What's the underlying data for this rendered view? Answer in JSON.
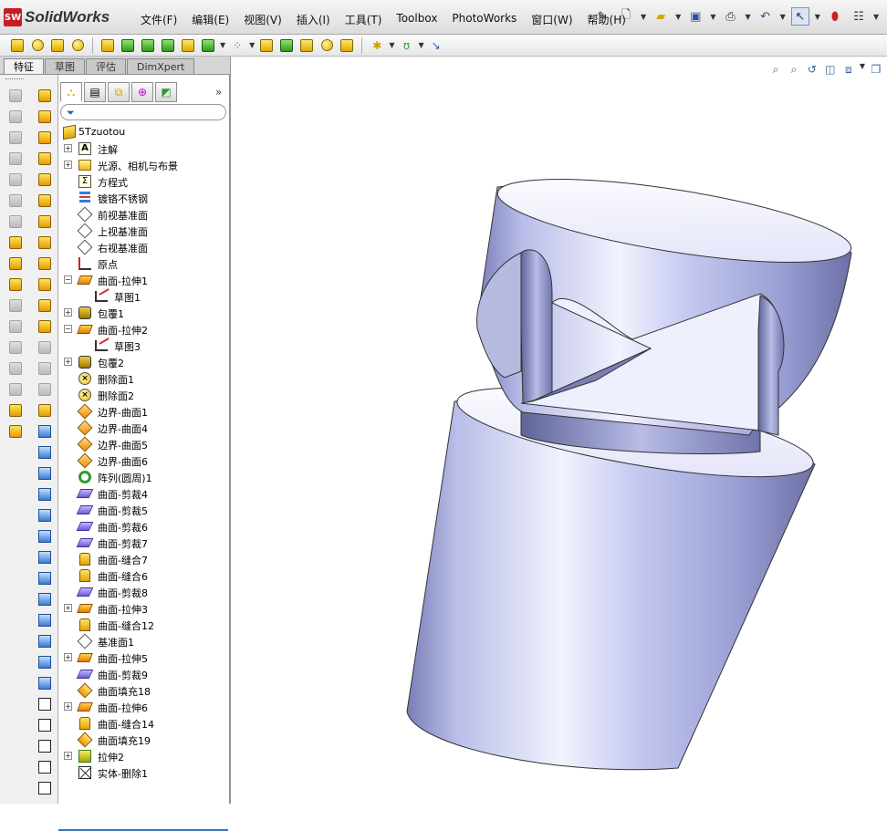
{
  "app": {
    "name": "SolidWorks",
    "logo_text": "SW"
  },
  "menu": [
    "文件(F)",
    "编辑(E)",
    "视图(V)",
    "插入(I)",
    "工具(T)",
    "Toolbox",
    "PhotoWorks",
    "窗口(W)",
    "帮助(H)"
  ],
  "quick_access": [
    "pin-icon",
    "new-document-icon",
    "open-icon",
    "save-icon",
    "print-icon",
    "undo-icon",
    "select-icon",
    "rebuild-icon",
    "options-icon"
  ],
  "command_tabs": [
    {
      "label": "特征",
      "active": true
    },
    {
      "label": "草图",
      "active": false
    },
    {
      "label": "评估",
      "active": false
    },
    {
      "label": "DimXpert",
      "active": false
    }
  ],
  "feature_manager": {
    "tabs": [
      "featuremanager-tab-icon",
      "propertymanager-tab-icon",
      "configurationmanager-tab-icon",
      "dimxpertmanager-tab-icon",
      "display-manager-tab-icon"
    ],
    "more_label": "»",
    "root": "5Tzuotou",
    "items": [
      {
        "label": "注解",
        "icon": "annotations",
        "exp": "+",
        "indent": 0
      },
      {
        "label": "光源、相机与布景",
        "icon": "lights",
        "exp": "+",
        "indent": 0
      },
      {
        "label": "方程式",
        "icon": "equations",
        "exp": "",
        "indent": 0
      },
      {
        "label": "镀铬不锈钢",
        "icon": "material",
        "exp": "",
        "indent": 0
      },
      {
        "label": "前视基准面",
        "icon": "plane",
        "exp": "",
        "indent": 0
      },
      {
        "label": "上视基准面",
        "icon": "plane",
        "exp": "",
        "indent": 0
      },
      {
        "label": "右视基准面",
        "icon": "plane",
        "exp": "",
        "indent": 0
      },
      {
        "label": "原点",
        "icon": "origin",
        "exp": "",
        "indent": 0
      },
      {
        "label": "曲面-拉伸1",
        "icon": "extrude",
        "exp": "−",
        "indent": 0
      },
      {
        "label": "草图1",
        "icon": "sketch",
        "exp": "",
        "indent": 1
      },
      {
        "label": "包覆1",
        "icon": "wrap",
        "exp": "+",
        "indent": 0
      },
      {
        "label": "曲面-拉伸2",
        "icon": "extrude",
        "exp": "−",
        "indent": 0
      },
      {
        "label": "草图3",
        "icon": "sketch",
        "exp": "",
        "indent": 1
      },
      {
        "label": "包覆2",
        "icon": "wrap",
        "exp": "+",
        "indent": 0
      },
      {
        "label": "删除面1",
        "icon": "delete-face",
        "exp": "",
        "indent": 0
      },
      {
        "label": "删除面2",
        "icon": "delete-face",
        "exp": "",
        "indent": 0
      },
      {
        "label": "边界-曲面1",
        "icon": "boundary",
        "exp": "",
        "indent": 0
      },
      {
        "label": "边界-曲面4",
        "icon": "boundary",
        "exp": "",
        "indent": 0
      },
      {
        "label": "边界-曲面5",
        "icon": "boundary",
        "exp": "",
        "indent": 0
      },
      {
        "label": "边界-曲面6",
        "icon": "boundary",
        "exp": "",
        "indent": 0
      },
      {
        "label": "阵列(圆周)1",
        "icon": "pattern",
        "exp": "",
        "indent": 0
      },
      {
        "label": "曲面-剪裁4",
        "icon": "trim",
        "exp": "",
        "indent": 0
      },
      {
        "label": "曲面-剪裁5",
        "icon": "trim",
        "exp": "",
        "indent": 0
      },
      {
        "label": "曲面-剪裁6",
        "icon": "trim",
        "exp": "",
        "indent": 0
      },
      {
        "label": "曲面-剪裁7",
        "icon": "trim",
        "exp": "",
        "indent": 0
      },
      {
        "label": "曲面-缝合7",
        "icon": "knit",
        "exp": "",
        "indent": 0
      },
      {
        "label": "曲面-缝合6",
        "icon": "knit",
        "exp": "",
        "indent": 0
      },
      {
        "label": "曲面-剪裁8",
        "icon": "trim",
        "exp": "",
        "indent": 0
      },
      {
        "label": "曲面-拉伸3",
        "icon": "extrude",
        "exp": "+",
        "indent": 0
      },
      {
        "label": "曲面-缝合12",
        "icon": "knit",
        "exp": "",
        "indent": 0
      },
      {
        "label": "基准面1",
        "icon": "plane",
        "exp": "",
        "indent": 0
      },
      {
        "label": "曲面-拉伸5",
        "icon": "extrude",
        "exp": "+",
        "indent": 0
      },
      {
        "label": "曲面-剪裁9",
        "icon": "trim",
        "exp": "",
        "indent": 0
      },
      {
        "label": "曲面填充18",
        "icon": "fill",
        "exp": "",
        "indent": 0
      },
      {
        "label": "曲面-拉伸6",
        "icon": "extrude",
        "exp": "+",
        "indent": 0
      },
      {
        "label": "曲面-缝合14",
        "icon": "knit",
        "exp": "",
        "indent": 0
      },
      {
        "label": "曲面填充19",
        "icon": "fill",
        "exp": "",
        "indent": 0
      },
      {
        "label": "拉伸2",
        "icon": "boss-extrude",
        "exp": "+",
        "indent": 0
      },
      {
        "label": "实体-删除1",
        "icon": "body-delete",
        "exp": "",
        "indent": 0
      }
    ]
  },
  "colors": {
    "model_light": "#e9ebfb",
    "model_mid": "#a9add9",
    "model_dark": "#6d71a8",
    "accent": "#3d6fb6"
  }
}
